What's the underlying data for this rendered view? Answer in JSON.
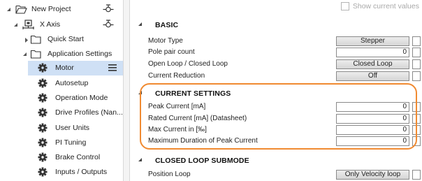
{
  "tree": {
    "items": [
      {
        "label": "New Project",
        "icon": "folder-open-icon",
        "caret": "expanded-caret"
      },
      {
        "label": "X Axis",
        "icon": "axis-icon",
        "caret": "expanded-caret"
      },
      {
        "label": "Quick Start",
        "icon": "folder-icon",
        "caret": "collapsed-caret"
      },
      {
        "label": "Application Settings",
        "icon": "folder-icon",
        "caret": "expanded-caret"
      },
      {
        "label": "Motor",
        "icon": "gear-icon"
      },
      {
        "label": "Autosetup",
        "icon": "gear-icon"
      },
      {
        "label": "Operation Mode",
        "icon": "gear-icon"
      },
      {
        "label": "Drive Profiles (Nan...",
        "icon": "gear-icon"
      },
      {
        "label": "User Units",
        "icon": "gear-icon"
      },
      {
        "label": "PI Tuning",
        "icon": "gear-icon"
      },
      {
        "label": "Brake Control",
        "icon": "gear-icon"
      },
      {
        "label": "Inputs / Outputs",
        "icon": "gear-icon"
      }
    ],
    "selected": "Motor"
  },
  "props": {
    "show_current_label": "Show current values",
    "basic": {
      "title": "BASIC",
      "rows": [
        {
          "label": "Motor Type",
          "value": "Stepper",
          "kind": "combo"
        },
        {
          "label": "Pole pair count",
          "value": "0",
          "kind": "input"
        },
        {
          "label": "Open Loop / Closed Loop",
          "value": "Closed Loop",
          "kind": "combo"
        },
        {
          "label": "Current Reduction",
          "value": "Off",
          "kind": "combo"
        }
      ]
    },
    "current": {
      "title": "CURRENT SETTINGS",
      "rows": [
        {
          "label": "Peak Current [mA]",
          "value": "0",
          "kind": "input"
        },
        {
          "label": "Rated Current [mA] (Datasheet)",
          "value": "0",
          "kind": "input"
        },
        {
          "label": "Max Current in  [‰]",
          "value": "0",
          "kind": "input"
        },
        {
          "label": "Maximum Duration of Peak Current",
          "value": "0",
          "kind": "input"
        }
      ]
    },
    "closed_loop": {
      "title": "CLOSED LOOP SUBMODE",
      "rows": [
        {
          "label": "Position Loop",
          "value": "Only Velocity loop",
          "kind": "combo"
        }
      ]
    }
  },
  "colors": {
    "highlight": "#f08a31",
    "selection": "#cfe0f5"
  }
}
